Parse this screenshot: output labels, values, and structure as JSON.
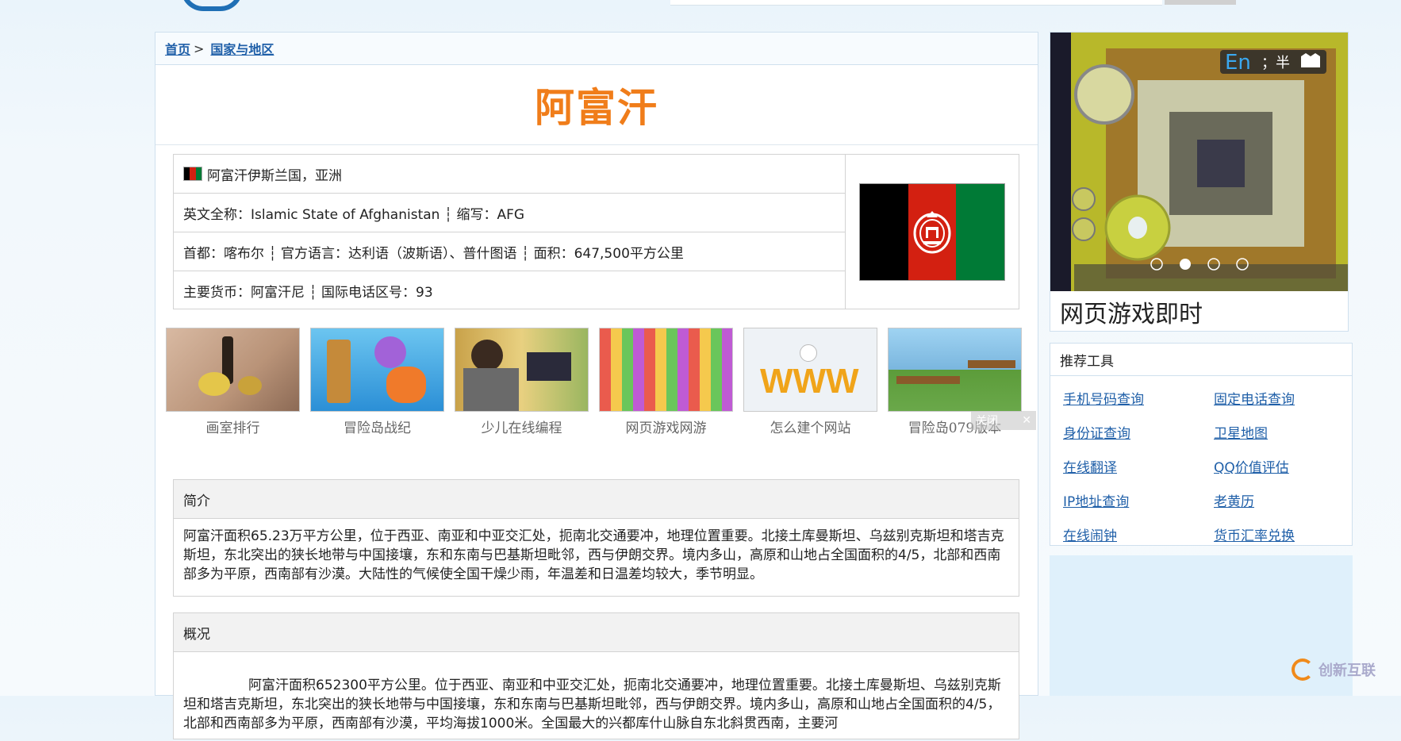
{
  "breadcrumb": {
    "home": "首页",
    "separator": ">",
    "current": "国家与地区"
  },
  "page_title": "阿富汗",
  "info": {
    "row1": "阿富汗伊斯兰国，亚洲",
    "row2": "英文全称：Islamic State of Afghanistan ┆ 缩写：AFG",
    "row3": "首都：喀布尔 ┆ 官方语言：达利语（波斯语）、普什图语 ┆ 面积：647,500平方公里",
    "row4": "主要货币：阿富汗尼 ┆ 国际电话区号：93",
    "flag_colors": [
      "#000000",
      "#d32011",
      "#007a36"
    ]
  },
  "ads": [
    {
      "caption": "画室排行"
    },
    {
      "caption": "冒险岛战纪"
    },
    {
      "caption": "少儿在线编程"
    },
    {
      "caption": "网页游戏网游"
    },
    {
      "caption": "怎么建个网站"
    },
    {
      "caption": "冒险岛079版本"
    }
  ],
  "ad_close": {
    "label": "关闭",
    "icon": "close-icon"
  },
  "intro": {
    "heading": "简介",
    "text": "阿富汗面积65.23万平方公里，位于西亚、南亚和中亚交汇处，扼南北交通要冲，地理位置重要。北接土库曼斯坦、乌兹别克斯坦和塔吉克斯坦，东北突出的狭长地带与中国接壤，东和东南与巴基斯坦毗邻，西与伊朗交界。境内多山，高原和山地占全国面积的4/5，北部和西南部多为平原，西南部有沙漠。大陆性的气候使全国干燥少雨，年温差和日温差均较大，季节明显。"
  },
  "overview": {
    "heading": "概况",
    "text": "阿富汗面积652300平方公里。位于西亚、南亚和中亚交汇处，扼南北交通要冲，地理位置重要。北接土库曼斯坦、乌兹别克斯坦和塔吉克斯坦，东北突出的狭长地带与中国接壤，东和东南与巴基斯坦毗邻，西与伊朗交界。境内多山，高原和山地占全国面积的4/5，北部和西南部多为平原，西南部有沙漠，平均海拔1000米。全国最大的兴都库什山脉自东北斜贯西南，主要河"
  },
  "sidebar_ad": {
    "caption": "网页游戏即时",
    "ime_label": "En",
    "ime_extra": "；半"
  },
  "tools": {
    "heading": "推荐工具",
    "links": [
      "手机号码查询",
      "固定电话查询",
      "身份证查询",
      "卫星地图",
      "在线翻译",
      "QQ价值评估",
      "IP地址查询",
      "老黄历",
      "在线闹钟",
      "货币汇率兑换"
    ]
  },
  "watermark": "创新互联"
}
